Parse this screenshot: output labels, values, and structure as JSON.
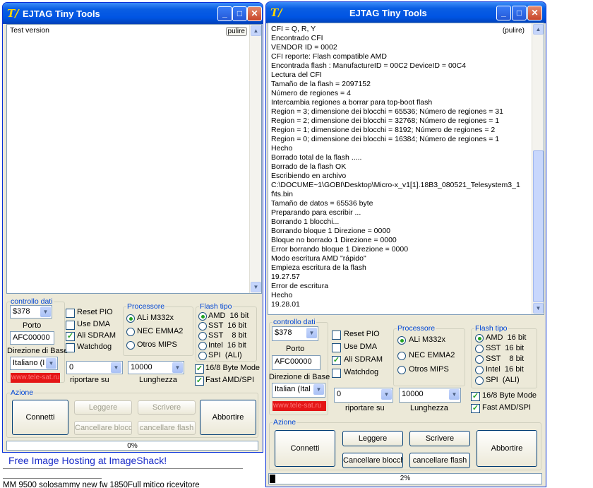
{
  "left_window": {
    "title": "EJTAG Tiny Tools",
    "log_lines": [
      "Test version"
    ],
    "pulire": "pulire",
    "controllo_dati": {
      "label": "controllo dati",
      "port": "$378",
      "porto_label": "Porto",
      "base_address": "AFC00000",
      "direzione_label": "Direzione di Base",
      "language": "Italiano (It",
      "link_text": "www.tele-sat.ru"
    },
    "checks": [
      {
        "label": "Reset PIO",
        "checked": false
      },
      {
        "label": "Use DMA",
        "checked": false
      },
      {
        "label": "Ali SDRAM",
        "checked": true
      },
      {
        "label": "Watchdog",
        "checked": false
      }
    ],
    "processore": {
      "label": "Processore",
      "options": [
        {
          "label": "ALi M332x",
          "selected": true
        },
        {
          "label": "NEC EMMA2",
          "selected": false
        },
        {
          "label": "Otros MIPS",
          "selected": false
        }
      ]
    },
    "flash_tipo": {
      "label": "Flash tipo",
      "options": [
        {
          "label": "AMD  16 bit",
          "selected": true
        },
        {
          "label": "SST  16 bit",
          "selected": false
        },
        {
          "label": "SST    8 bit",
          "selected": false
        },
        {
          "label": "Intel  16 bit",
          "selected": false
        },
        {
          "label": "SPI  (ALI)",
          "selected": false
        }
      ],
      "byte_mode": {
        "label": "16/8 Byte Mode",
        "checked": true
      },
      "fast": {
        "label": "Fast AMD/SPI",
        "checked": true
      }
    },
    "riportare": {
      "value": "0",
      "label": "riportare su"
    },
    "lunghezza": {
      "value": "10000",
      "label": "Lunghezza"
    },
    "azione": {
      "label": "Azione",
      "connetti": "Connetti",
      "leggere": "Leggere",
      "scrivere": "Scrivere",
      "cancellare_blocco": "Cancellare blocch",
      "cancellare_flash": "cancellare flash",
      "abbortire": "Abbortire"
    },
    "progress": {
      "value": 0,
      "text": "0%"
    }
  },
  "right_window": {
    "title": "EJTAG Tiny Tools",
    "pulire": "(pulire)",
    "log_lines": [
      "CFI  = Q, R, Y",
      "Encontrado CFI",
      "VENDOR ID = 0002",
      "CFI reporte: Flash compatible AMD",
      "Encontrada flash : ManufactureID = 00C2 DeviceID = 00C4",
      "Lectura del CFI",
      "Tamaño de la flash = 2097152",
      "Número de regiones = 4",
      "Intercambia regiones a borrar para top-boot flash",
      "Region = 3; dimensione dei blocchi = 65536; Número de regiones = 31",
      "Region = 2; dimensione dei blocchi = 32768; Número de regiones = 1",
      "Region = 1; dimensione dei blocchi = 8192; Número de regiones = 2",
      "Region = 0; dimensione dei blocchi = 16384; Número de regiones = 1",
      "Hecho",
      "Borrado total de la flash .....",
      "Borrado de la flash OK",
      "Escribiendo en archivo",
      "C:\\DOCUME~1\\GOBI\\Desktop\\Micro-x_v1[1].18B3_080521_Telesystem3_1",
      "f\\ts.bin",
      "Tamaño de datos = 65536 byte",
      "Preparando para escribir ...",
      "Borrando 1 blocchi...",
      "Borrando bloque 1 Direzione = 0000",
      "Bloque no borrado 1 Direzione = 0000",
      "Error borrando bloque 1 Direzione = 0000",
      "Modo escritura AMD \"rápido\"",
      "Empieza escritura de la flash",
      "19.27.57",
      "Error de escritura",
      "Hecho",
      "19.28.01"
    ],
    "controllo_dati": {
      "label": "controllo dati",
      "port": "$378",
      "porto_label": "Porto",
      "base_address": "AFC00000",
      "direzione_label": "Direzione di Base",
      "language": "Italian (Ital",
      "link_text": "www.tele-sat.ru"
    },
    "checks": [
      {
        "label": "Reset PIO",
        "checked": false
      },
      {
        "label": "Use DMA",
        "checked": false
      },
      {
        "label": "Ali SDRAM",
        "checked": true
      },
      {
        "label": "Watchdog",
        "checked": false
      }
    ],
    "processore": {
      "label": "Processore",
      "options": [
        {
          "label": "ALi M332x",
          "selected": true
        },
        {
          "label": "NEC EMMA2",
          "selected": false
        },
        {
          "label": "Otros MIPS",
          "selected": false
        }
      ]
    },
    "flash_tipo": {
      "label": "Flash tipo",
      "options": [
        {
          "label": "AMD  16 bit",
          "selected": true
        },
        {
          "label": "SST  16 bit",
          "selected": false
        },
        {
          "label": "SST    8 bit",
          "selected": false
        },
        {
          "label": "Intel  16 bit",
          "selected": false
        },
        {
          "label": "SPI  (ALI)",
          "selected": false
        }
      ],
      "byte_mode": {
        "label": "16/8 Byte Mode",
        "checked": true
      },
      "fast": {
        "label": "Fast AMD/SPI",
        "checked": true
      }
    },
    "riportare": {
      "value": "0",
      "label": "riportare su"
    },
    "lunghezza": {
      "value": "10000",
      "label": "Lunghezza"
    },
    "azione": {
      "label": "Azione",
      "connetti": "Connetti",
      "leggere": "Leggere",
      "scrivere": "Scrivere",
      "cancellare_blocco": "Cancellare blocch",
      "cancellare_flash": "cancellare flash",
      "abbortire": "Abbortire"
    },
    "progress": {
      "value": 2,
      "text": "2%"
    }
  },
  "page": {
    "hosting_link": "Free Image Hosting at ImageShack!",
    "caption": "MM 9500 solosammy new fw 1850Full mitico ricevitore"
  }
}
